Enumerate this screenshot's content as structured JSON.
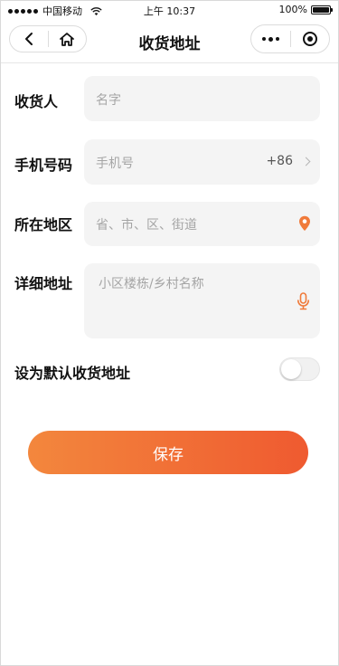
{
  "status_bar": {
    "carrier": "中国移动",
    "time": "上午 10:37",
    "battery": "100%"
  },
  "nav": {
    "title": "收货地址"
  },
  "form": {
    "recipient": {
      "label": "收货人",
      "placeholder": "名字"
    },
    "phone": {
      "label": "手机号码",
      "placeholder": "手机号",
      "country_code": "+86"
    },
    "region": {
      "label": "所在地区",
      "placeholder": "省、市、区、街道"
    },
    "detail": {
      "label": "详细地址",
      "placeholder": "小区楼栋/乡村名称"
    },
    "default": {
      "label": "设为默认收货地址",
      "enabled": false
    }
  },
  "actions": {
    "save_label": "保存"
  },
  "colors": {
    "accent_start": "#f3873d",
    "accent_end": "#ef5a30",
    "icon_accent": "#f07a3a"
  },
  "icons": [
    "back-icon",
    "home-icon",
    "more-icon",
    "target-icon",
    "location-pin-icon",
    "microphone-icon",
    "chevron-right-icon",
    "wifi-icon",
    "battery-icon"
  ]
}
